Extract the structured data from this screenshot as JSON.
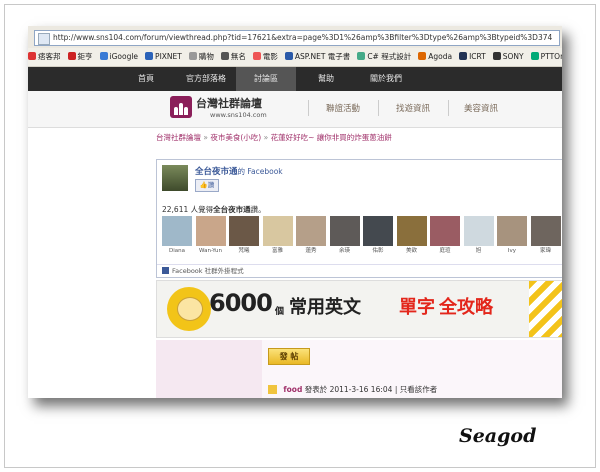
{
  "address_bar": {
    "url": "http://www.sns104.com/forum/viewthread.php?tid=17621&extra=page%3D1%26amp%3Bfilter%3Dtype%26amp%3Btypeid%3D374"
  },
  "bookmarks": [
    "痞客邦",
    "鉅亨",
    "iGoogle",
    "PIXNET",
    "購物",
    "無名",
    "電影",
    "ASP.NET 電子書",
    "C# 程式設計",
    "Agoda",
    "ICRT",
    "SONY",
    "PTTOnline"
  ],
  "nav": {
    "items": [
      "首頁",
      "官方部落格",
      "討論區",
      "幫助",
      "關於我們"
    ],
    "active_index": 2
  },
  "header": {
    "logo_title": "台灣社群論壇",
    "logo_sub": "www.sns104.com",
    "links": [
      "聯誼活動",
      "找遊資訊",
      "美容資訊"
    ]
  },
  "breadcrumb": {
    "items": [
      "台灣社群論壇",
      "夜市美食(小吃)",
      "花蓮好好吃~ 讓你非買的炸蛋蔥油餅"
    ],
    "separator": "»"
  },
  "facebook": {
    "page_name": "全台夜市通",
    "page_suffix": "的 Facebook",
    "like_label": "讚",
    "fan_count": "22,611",
    "fan_text_prefix": "人覺得",
    "fan_text_name": "全台夜市通",
    "fan_text_suffix": "讚。",
    "fans": [
      {
        "label": "Diana",
        "color": "#9fb8c9"
      },
      {
        "label": "Wan-Yun",
        "color": "#c9a68a"
      },
      {
        "label": "梵曦",
        "color": "#6b5847"
      },
      {
        "label": "富雅",
        "color": "#d8c7a0"
      },
      {
        "label": "蓮秀",
        "color": "#b59f89"
      },
      {
        "label": "余瑛",
        "color": "#5e5a58"
      },
      {
        "label": "佑彰",
        "color": "#44494f"
      },
      {
        "label": "美欲",
        "color": "#8a6f3c"
      },
      {
        "label": "庭瑄",
        "color": "#9a5c63"
      },
      {
        "label": "旭",
        "color": "#cfd9df"
      },
      {
        "label": "Ivy",
        "color": "#a7937e"
      },
      {
        "label": "家瑋",
        "color": "#6e655e"
      }
    ],
    "footer": "Facebook 社群外掛程式"
  },
  "banner": {
    "number": "6000",
    "unit": "個",
    "text": "常用英文",
    "highlight1": "單字",
    "highlight2": "全攻略"
  },
  "post": {
    "reply_label": "發 帖",
    "author": "food",
    "posted_label": "發表於",
    "timestamp": "2011-3-16 16:04",
    "separator": "|",
    "view_author": "只看該作者"
  },
  "signature": "Seagod"
}
